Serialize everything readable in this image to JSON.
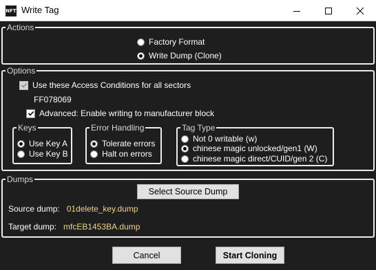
{
  "window": {
    "title": "Write Tag",
    "app_icon_text": "NFT"
  },
  "actions": {
    "legend": "Actions",
    "options": [
      {
        "label": "Factory Format",
        "checked": false
      },
      {
        "label": "Write Dump (Clone)",
        "checked": true
      }
    ]
  },
  "options": {
    "legend": "Options",
    "use_access_label": "Use these Access Conditions for all sectors",
    "access_value": "FF078069",
    "advanced_label": "Advanced: Enable writing to manufacturer block",
    "keys": {
      "legend": "Keys",
      "items": [
        {
          "label": "Use Key A",
          "checked": true
        },
        {
          "label": "Use Key B",
          "checked": false
        }
      ]
    },
    "error_handling": {
      "legend": "Error Handling",
      "items": [
        {
          "label": "Tolerate errors",
          "checked": true
        },
        {
          "label": "Halt on errors",
          "checked": false
        }
      ]
    },
    "tag_type": {
      "legend": "Tag Type",
      "items": [
        {
          "label": "Not 0 writable (w)",
          "checked": false
        },
        {
          "label": "chinese magic unlocked/gen1 (W)",
          "checked": true
        },
        {
          "label": "chinese magic direct/CUID/gen 2 (C)",
          "checked": false
        }
      ]
    }
  },
  "dumps": {
    "legend": "Dumps",
    "select_button": "Select Source Dump",
    "source_label": "Source dump:",
    "source_value": "01delete_key.dump",
    "target_label": "Target dump:",
    "target_value": "mfcEB1453BA.dump"
  },
  "buttons": {
    "cancel": "Cancel",
    "start": "Start Cloning"
  }
}
